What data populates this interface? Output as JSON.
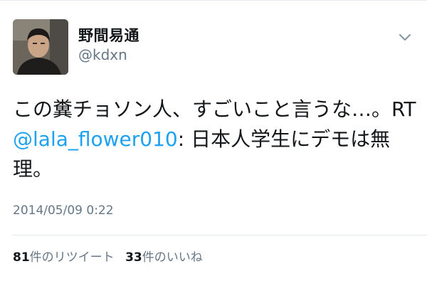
{
  "user": {
    "display_name": "野間易通",
    "screen_name": "@kdxn"
  },
  "tweet": {
    "text_before": "この糞チョソン人、すごいこと言うな…。RT ",
    "mention": "@lala_flower010",
    "text_after": ": 日本人学生にデモは無理。",
    "timestamp": "2014/05/09 0:22"
  },
  "stats": {
    "retweets_count": "81",
    "retweets_label": "件のリツイート",
    "likes_count": "33",
    "likes_label": "件のいいね"
  },
  "icons": {
    "menu": "chevron-down-icon"
  },
  "colors": {
    "link": "#1da1f2",
    "secondary_text": "#657786",
    "primary_text": "#14171a",
    "divider": "#e1e8ed"
  }
}
